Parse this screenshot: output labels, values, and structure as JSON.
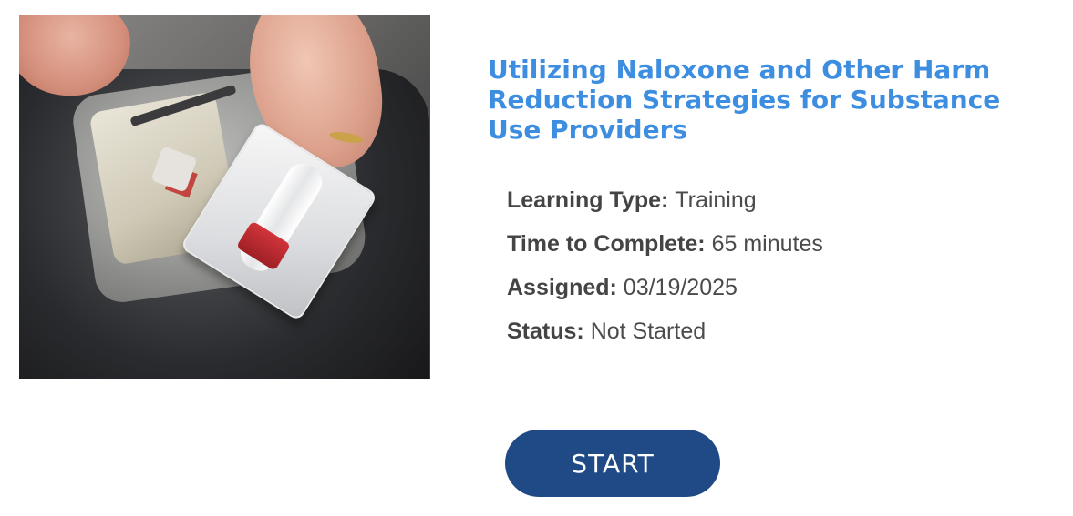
{
  "course": {
    "title": "Utilizing Naloxone and Other Harm Reduction Strategies for Substance Use Providers",
    "details": [
      {
        "label": "Learning Type:",
        "value": "Training"
      },
      {
        "label": "Time to Complete:",
        "value": "65 minutes"
      },
      {
        "label": "Assigned:",
        "value": "03/19/2025"
      },
      {
        "label": "Status:",
        "value": "Not Started"
      }
    ],
    "start_label": "START"
  },
  "colors": {
    "title": "#3d8ee0",
    "button": "#1f4a86",
    "button_text": "#ffffff",
    "meta_text": "#4b4b4b"
  }
}
